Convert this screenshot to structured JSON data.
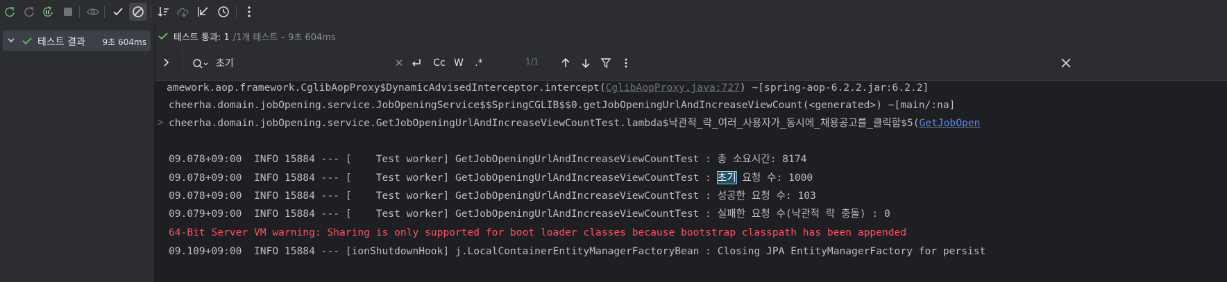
{
  "toolbar": {
    "items": [
      {
        "name": "rerun-icon"
      },
      {
        "name": "rerun-failed-icon"
      },
      {
        "name": "toggle-auto-test-icon"
      },
      {
        "name": "stop-icon"
      },
      {
        "name": "show-passed-icon"
      },
      {
        "name": "show-ignored-icon"
      },
      {
        "name": "sort-icon"
      },
      {
        "name": "import-tests-icon"
      },
      {
        "name": "collapse-icon"
      },
      {
        "name": "history-icon"
      },
      {
        "name": "more-icon"
      }
    ]
  },
  "tree": {
    "root_label": "테스트 결과",
    "root_time": "9초 604ms"
  },
  "status": {
    "main": "테스트 통과: 1",
    "rest": "/1개 테스트 – 9초 604ms"
  },
  "search": {
    "query": "초기",
    "opt_case": "Cc",
    "opt_word": "W",
    "opt_regex": ".*",
    "match_count": "1/1"
  },
  "log": {
    "line1_pre": "amework.aop.framework.CglibAopProxy$DynamicAdvisedInterceptor.intercept(",
    "line1_link": "CglibAopProxy.java:727",
    "line1_post": ") ~[spring-aop-6.2.2.jar:6.2.2]",
    "line2": "cheerha.domain.jobOpening.service.JobOpeningService$$SpringCGLIB$$0.getJobOpeningUrlAndIncreaseViewCount(<generated>) ~[main/:na]",
    "line3_marker": ">",
    "line3_pre": "cheerha.domain.jobOpening.service.GetJobOpeningUrlAndIncreaseViewCountTest.lambda$낙관적_락_여러_사용자가_동시에_채용공고를_클릭함$5(",
    "line3_link": "GetJobOpen",
    "line4": "09.078+09:00  INFO 15884 --- [    Test worker] GetJobOpeningUrlAndIncreaseViewCountTest : 총 소요시간: 8174",
    "line5_pre": "09.078+09:00  INFO 15884 --- [    Test worker] GetJobOpeningUrlAndIncreaseViewCountTest : ",
    "line5_hl": "초기",
    "line5_post": " 요청 수: 1000",
    "line6": "09.078+09:00  INFO 15884 --- [    Test worker] GetJobOpeningUrlAndIncreaseViewCountTest : 성공한 요청 수: 103",
    "line7": "09.079+09:00  INFO 15884 --- [    Test worker] GetJobOpeningUrlAndIncreaseViewCountTest : 실패한 요청 수(낙관적 락 충돌) : 0",
    "line8": "64-Bit Server VM warning: Sharing is only supported for boot loader classes because bootstrap classpath has been appended",
    "line9": "09.109+09:00  INFO 15884 --- [ionShutdownHook] j.LocalContainerEntityManagerFactoryBean : Closing JPA EntityManagerFactory for persist"
  },
  "colors": {
    "pass_green": "#5fb865",
    "warn_red": "#f75464",
    "link_blue": "#548af7",
    "background": "#1e1f22",
    "panel": "#2b2d30"
  }
}
